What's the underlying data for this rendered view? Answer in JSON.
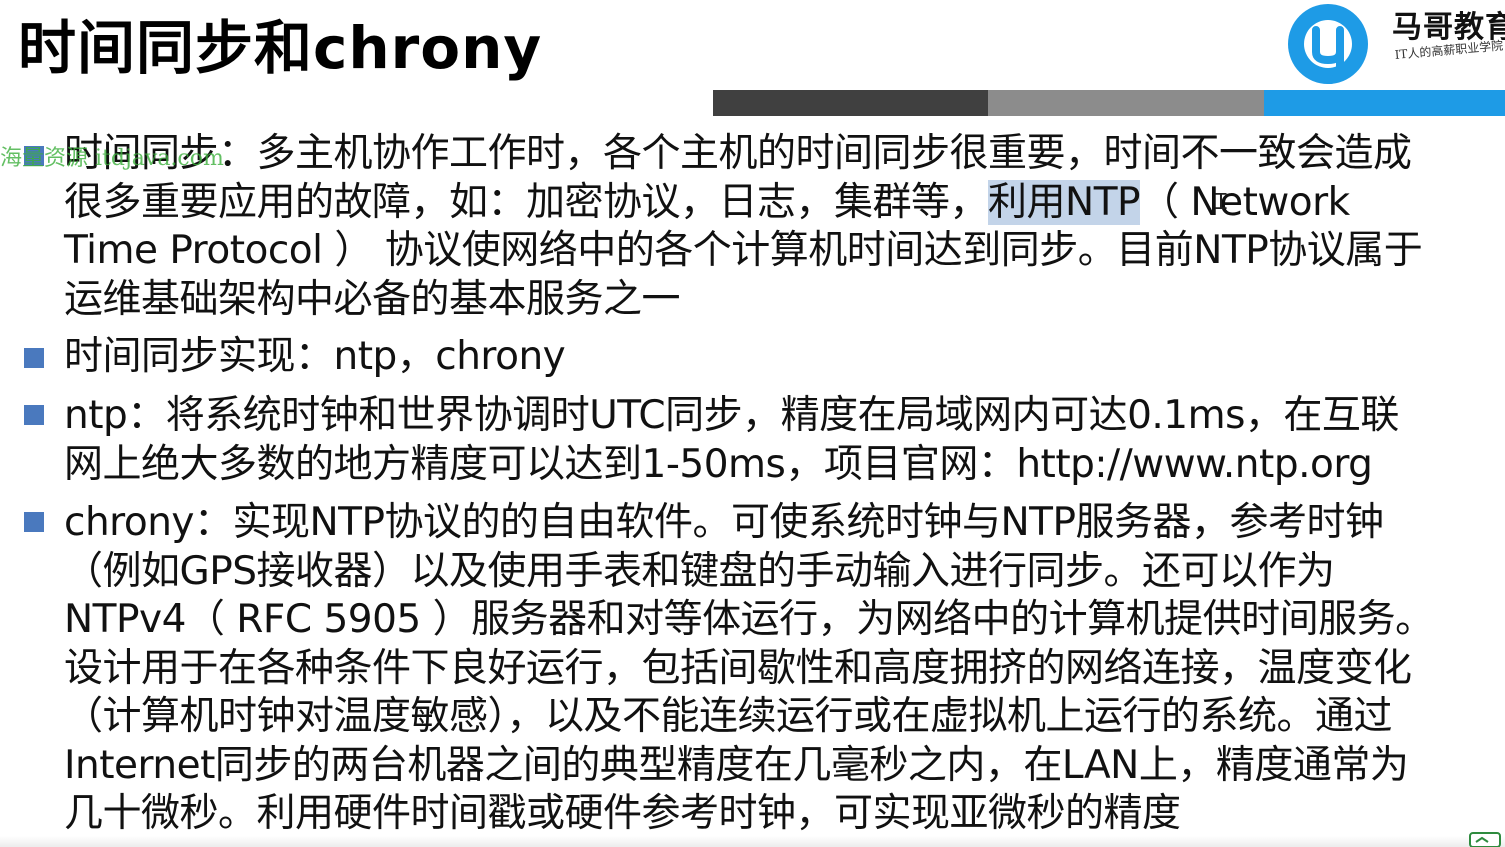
{
  "title": "时间同步和chrony",
  "logo": {
    "name": "马哥教育",
    "slogan": "IT人的高薪职业学院",
    "mark_color": "#1e9be6"
  },
  "header_bar": {
    "colors": [
      "#404040",
      "#8c8c8c",
      "#1e9be6"
    ]
  },
  "watermark": "海量资源 itdjava.com",
  "bullets": [
    {
      "before": "时间同步：多主机协作工作时，各个主机的时间同步很重要，时间不一致会造成\n很多重要应用的故障，如：加密协议，日志，集群等，",
      "highlight": "利用NTP",
      "after": "（ Network\nTime Protocol ） 协议使网络中的各个计算机时间达到同步。目前NTP协议属于\n运维基础架构中必备的基本服务之一"
    },
    {
      "text": "时间同步实现：ntp，chrony"
    },
    {
      "text": "ntp：将系统时钟和世界协调时UTC同步，精度在局域网内可达0.1ms，在互联\n网上绝大多数的地方精度可以达到1-50ms，项目官网：http://www.ntp.org"
    },
    {
      "text": "chrony：实现NTP协议的的自由软件。可使系统时钟与NTP服务器，参考时钟\n（例如GPS接收器）以及使用手表和键盘的手动输入进行同步。还可以作为\nNTPv4（ RFC 5905 ）服务器和对等体运行，为网络中的计算机提供时间服务。\n设计用于在各种条件下良好运行，包括间歇性和高度拥挤的网络连接，温度变化\n（计算机时钟对温度敏感），以及不能连续运行或在虚拟机上运行的系统。通过\nInternet同步的两台机器之间的典型精度在几毫秒之内，在LAN上，精度通常为\n几十微秒。利用硬件时间戳或硬件参考时钟，可实现亚微秒的精度"
    }
  ],
  "colors": {
    "bullet": "#4a79be",
    "highlight": "#c3d4e9",
    "watermark": "#3caf3c"
  }
}
